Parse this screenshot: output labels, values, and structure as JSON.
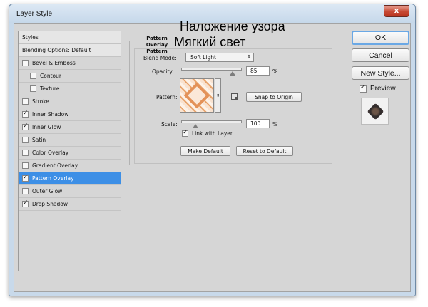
{
  "window": {
    "title": "Layer Style",
    "close_label": "x"
  },
  "styles_list": [
    {
      "label": "Styles",
      "header": true
    },
    {
      "label": "Blending Options: Default",
      "header": true
    },
    {
      "label": "Bevel & Emboss",
      "checked": false
    },
    {
      "label": "Contour",
      "checked": false,
      "indent": true
    },
    {
      "label": "Texture",
      "checked": false,
      "indent": true
    },
    {
      "label": "Stroke",
      "checked": false
    },
    {
      "label": "Inner Shadow",
      "checked": true
    },
    {
      "label": "Inner Glow",
      "checked": true
    },
    {
      "label": "Satin",
      "checked": false
    },
    {
      "label": "Color Overlay",
      "checked": false
    },
    {
      "label": "Gradient Overlay",
      "checked": false
    },
    {
      "label": "Pattern Overlay",
      "checked": true,
      "selected": true
    },
    {
      "label": "Outer Glow",
      "checked": false
    },
    {
      "label": "Drop Shadow",
      "checked": true
    }
  ],
  "panel": {
    "title_line1": "Pattern Overlay",
    "title_line2": "Pattern",
    "blend_mode_label": "Blend Mode:",
    "blend_mode_value": "Soft Light",
    "opacity_label": "Opacity:",
    "opacity_value": "85",
    "opacity_unit": "%",
    "opacity_fraction": 0.85,
    "pattern_label": "Pattern:",
    "snap_button": "Snap to Origin",
    "scale_label": "Scale:",
    "scale_value": "100",
    "scale_unit": "%",
    "scale_fraction": 0.24,
    "link_label": "Link with Layer",
    "link_checked": true,
    "make_default": "Make Default",
    "reset_default": "Reset to Default"
  },
  "annotations": {
    "line1": "Наложение узора",
    "line2": "Мягкий свет"
  },
  "right": {
    "ok": "OK",
    "cancel": "Cancel",
    "new_style": "New Style...",
    "preview_label": "Preview",
    "preview_checked": true
  },
  "check_glyph": "✓",
  "dropdown_glyph": "⇕",
  "colors": {
    "selection": "#3d8fe6",
    "title_bar": "#c8d9ea",
    "close_button": "#c74a35"
  }
}
